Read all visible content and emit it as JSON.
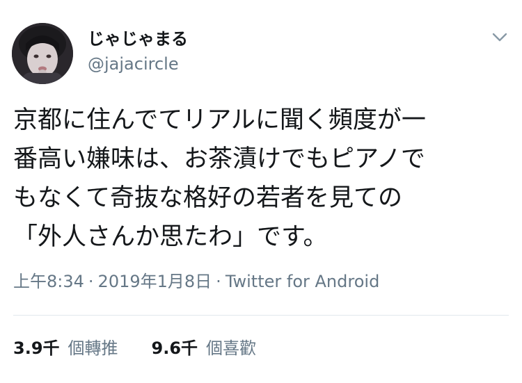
{
  "user": {
    "display_name": "じゃじゃまる",
    "handle": "@jajacircle"
  },
  "menu_icon": "chevron-down-icon",
  "tweet": {
    "lines": [
      "京都に住んでてリアルに聞く頻度が一",
      "番高い嫌味は、お茶漬けでもピアノで",
      "もなくて奇抜な格好の若者を見ての",
      "「外人さんか思たわ」です。"
    ]
  },
  "meta": {
    "time": "上午8:34",
    "separator": "·",
    "date": "2019年1月8日",
    "source": "Twitter for Android"
  },
  "stats": {
    "retweets_count": "3.9千",
    "retweets_label": "個轉推",
    "likes_count": "9.6千",
    "likes_label": "個喜歡"
  },
  "colors": {
    "text": "#14171a",
    "secondary": "#657786",
    "divider": "#e1e8ed"
  }
}
